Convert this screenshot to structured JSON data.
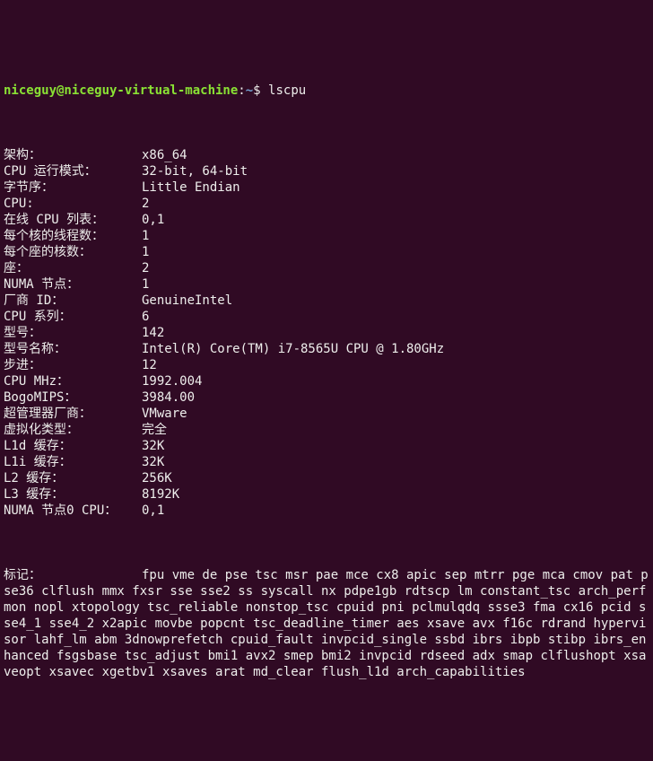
{
  "prompt": {
    "user": "niceguy@niceguy-virtual-machine",
    "colon": ":",
    "path": "~",
    "dollar": "$ ",
    "cmd": "lscpu"
  },
  "rows": [
    {
      "label": "架构：",
      "value": "x86_64"
    },
    {
      "label": "CPU 运行模式：",
      "value": "32-bit, 64-bit"
    },
    {
      "label": "字节序：",
      "value": "Little Endian"
    },
    {
      "label": "CPU:",
      "value": "2"
    },
    {
      "label": "在线 CPU 列表：",
      "value": "0,1"
    },
    {
      "label": "每个核的线程数：",
      "value": "1"
    },
    {
      "label": "每个座的核数：",
      "value": "1"
    },
    {
      "label": "座：",
      "value": "2"
    },
    {
      "label": "NUMA 节点：",
      "value": "1"
    },
    {
      "label": "厂商 ID：",
      "value": "GenuineIntel"
    },
    {
      "label": "CPU 系列：",
      "value": "6"
    },
    {
      "label": "型号：",
      "value": "142"
    },
    {
      "label": "型号名称：",
      "value": "Intel(R) Core(TM) i7-8565U CPU @ 1.80GHz"
    },
    {
      "label": "步进：",
      "value": "12"
    },
    {
      "label": "CPU MHz：",
      "value": "1992.004"
    },
    {
      "label": "BogoMIPS：",
      "value": "3984.00"
    },
    {
      "label": "超管理器厂商：",
      "value": "VMware"
    },
    {
      "label": "虚拟化类型：",
      "value": "完全"
    },
    {
      "label": "L1d 缓存：",
      "value": "32K"
    },
    {
      "label": "L1i 缓存：",
      "value": "32K"
    },
    {
      "label": "L2 缓存：",
      "value": "256K"
    },
    {
      "label": "L3 缓存：",
      "value": "8192K"
    },
    {
      "label": "NUMA 节点0 CPU：",
      "value": "0,1"
    }
  ],
  "flags_label": "标记：",
  "flags_value": "fpu vme de pse tsc msr pae mce cx8 apic sep mtrr pge mca cmov pat pse36 clflush mmx fxsr sse sse2 ss syscall nx pdpe1gb rdtscp lm constant_tsc arch_perfmon nopl xtopology tsc_reliable nonstop_tsc cpuid pni pclmulqdq ssse3 fma cx16 pcid sse4_1 sse4_2 x2apic movbe popcnt tsc_deadline_timer aes xsave avx f16c rdrand hypervisor lahf_lm abm 3dnowprefetch cpuid_fault invpcid_single ssbd ibrs ibpb stibp ibrs_enhanced fsgsbase tsc_adjust bmi1 avx2 smep bmi2 invpcid rdseed adx smap clflushopt xsaveopt xsavec xgetbv1 xsaves arat md_clear flush_l1d arch_capabilities"
}
